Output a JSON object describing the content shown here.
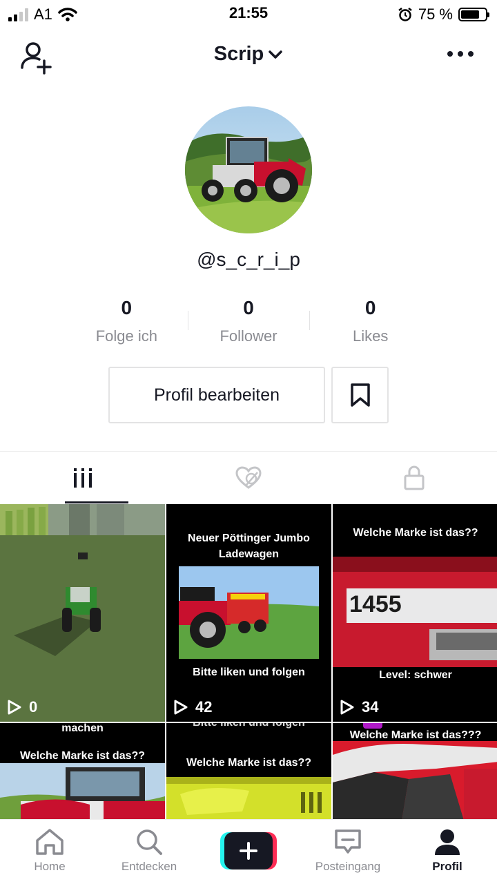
{
  "status_bar": {
    "carrier": "A1",
    "time": "21:55",
    "battery_pct": "75 %",
    "battery_level": 0.75,
    "signal_bars_active": 2,
    "signal_bars_total": 4
  },
  "header": {
    "title": "Scrip",
    "add_user_icon": "add-user-icon",
    "more_icon": "more-dots-icon"
  },
  "profile": {
    "username": "@s_c_r_i_p",
    "avatar": "tractor-photo"
  },
  "stats": [
    {
      "value": "0",
      "label": "Folge ich"
    },
    {
      "value": "0",
      "label": "Follower"
    },
    {
      "value": "0",
      "label": "Likes"
    }
  ],
  "buttons": {
    "edit_profile": "Profil bearbeiten",
    "bookmark_icon": "bookmark-icon"
  },
  "tabs": [
    {
      "icon": "grid-bars-icon",
      "active": true
    },
    {
      "icon": "hidden-heart-icon",
      "active": false
    },
    {
      "icon": "lock-icon",
      "active": false
    }
  ],
  "videos": [
    {
      "views": "0",
      "captions": []
    },
    {
      "views": "42",
      "captions": [
        "Neuer Pöttinger Jumbo",
        "Ladewagen",
        "Bitte liken und folgen"
      ]
    },
    {
      "views": "34",
      "captions": [
        "Welche Marke ist das??",
        "1455",
        "Level: schwer"
      ]
    },
    {
      "captions": [
        "machen",
        "Welche Marke ist das??"
      ]
    },
    {
      "captions": [
        "Bitte liken und folgen",
        "Welche Marke ist das??"
      ]
    },
    {
      "captions": [
        "Welche Marke ist das???"
      ]
    }
  ],
  "bottom_nav": [
    {
      "label": "Home",
      "icon": "home-icon"
    },
    {
      "label": "Entdecken",
      "icon": "search-icon"
    },
    {
      "label": "",
      "icon": "plus-icon"
    },
    {
      "label": "Posteingang",
      "icon": "inbox-icon"
    },
    {
      "label": "Profil",
      "icon": "profile-icon",
      "active": true
    }
  ],
  "colors": {
    "text": "#161823",
    "muted": "#8a8b91",
    "accent_pink": "#fe2c55",
    "accent_cyan": "#25f4ee"
  }
}
